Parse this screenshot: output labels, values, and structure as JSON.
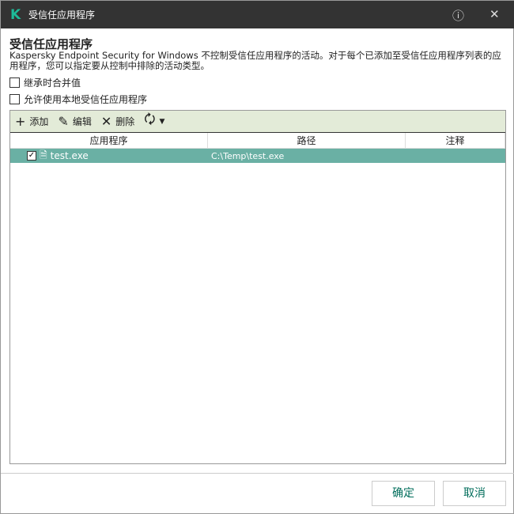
{
  "window": {
    "title": "受信任应用程序",
    "logo": "K"
  },
  "heading": "受信任应用程序",
  "description": "Kaspersky Endpoint Security for Windows 不控制受信任应用程序的活动。对于每个已添加至受信任应用程序列表的应用程序，您可以指定要从控制中排除的活动类型。",
  "options": [
    {
      "label": "继承时合并值",
      "checked": false
    },
    {
      "label": "允许使用本地受信任应用程序",
      "checked": false
    }
  ],
  "toolbar": {
    "add": "添加",
    "edit": "编辑",
    "delete": "删除"
  },
  "table": {
    "columns": [
      "应用程序",
      "路径",
      "注释"
    ],
    "rows": [
      {
        "checked": true,
        "app": "test.exe",
        "path": "C:\\Temp\\test.exe",
        "comment": ""
      }
    ]
  },
  "buttons": {
    "ok": "确定",
    "cancel": "取消"
  }
}
